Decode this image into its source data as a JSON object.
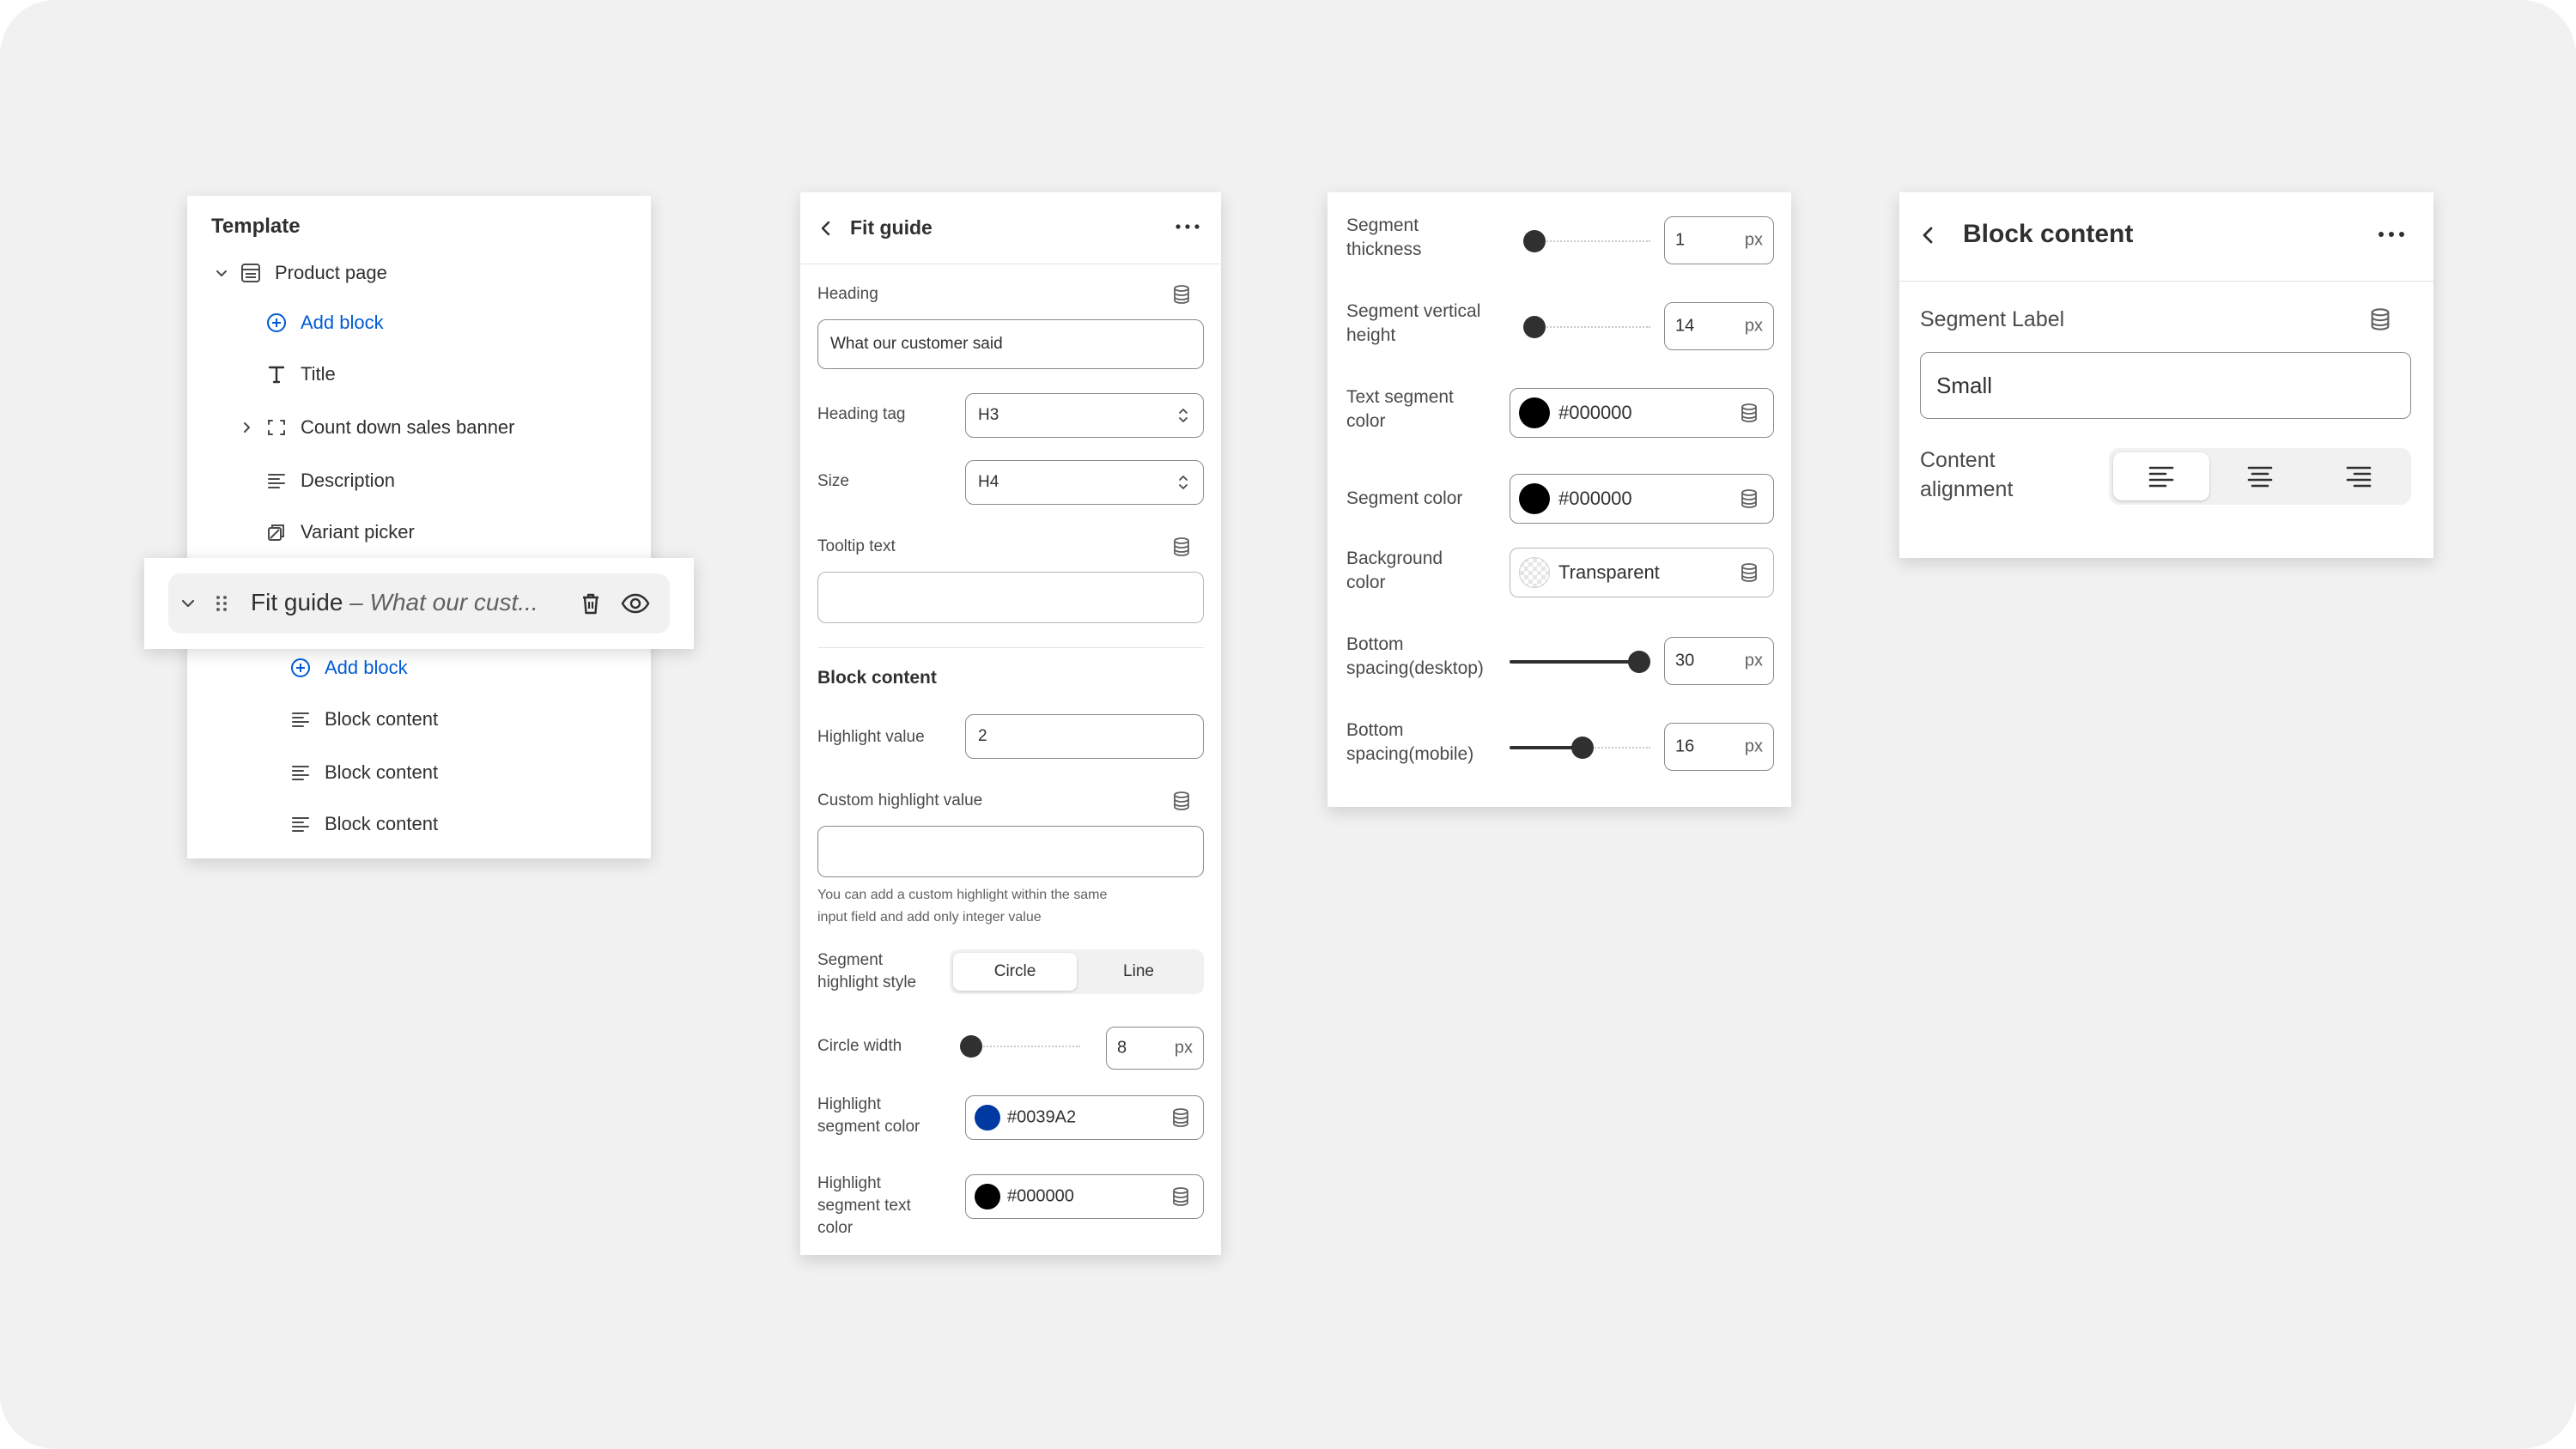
{
  "template_panel": {
    "title": "Template",
    "product_page": "Product page",
    "add_block_top": "Add block",
    "items": [
      "Title",
      "Count down sales banner",
      "Description",
      "Variant picker"
    ],
    "fit_guide_name": "Fit guide",
    "fit_guide_subtitle": " – What our cust...",
    "add_block_nested": "Add block",
    "nested_items": [
      "Block content",
      "Block content",
      "Block content"
    ]
  },
  "fit_guide_panel": {
    "title": "Fit guide",
    "heading_label": "Heading",
    "heading_value": "What our customer said",
    "heading_tag_label": "Heading tag",
    "heading_tag_value": "H3",
    "size_label": "Size",
    "size_value": "H4",
    "tooltip_label": "Tooltip text",
    "tooltip_value": "",
    "block_content_title": "Block content",
    "highlight_value_label": "Highlight value",
    "highlight_value": "2",
    "custom_highlight_label": "Custom highlight value",
    "custom_highlight_value": "",
    "help_line1": "You can add a custom highlight within the same",
    "help_line2": "input field and add only integer value",
    "seg_style_label1": "Segment",
    "seg_style_label2": "highlight style",
    "seg_style_options": [
      "Circle",
      "Line"
    ],
    "seg_style_selected": "Circle",
    "circle_width_label": "Circle width",
    "circle_width_value": "8",
    "circle_width_unit": "px",
    "circle_width_fraction": 0.0,
    "hl_seg_color_label1": "Highlight",
    "hl_seg_color_label2": "segment color",
    "hl_seg_color": "#0039A2",
    "hl_text_color_label1": "Highlight",
    "hl_text_color_label2": "segment text",
    "hl_text_color_label3": "color",
    "hl_text_color": "#000000"
  },
  "segment_panel": {
    "thickness_label1": "Segment",
    "thickness_label2": "thickness",
    "thickness_value": "1",
    "thickness_fraction": 0.0,
    "vheight_label1": "Segment vertical",
    "vheight_label2": "height",
    "vheight_value": "14",
    "vheight_fraction": 0.0,
    "text_color_label1": "Text segment",
    "text_color_label2": "color",
    "text_color": "#000000",
    "seg_color_label": "Segment color",
    "seg_color": "#000000",
    "bg_color_label1": "Background",
    "bg_color_label2": "color",
    "bg_color": "Transparent",
    "bottom_desktop_label1": "Bottom",
    "bottom_desktop_label2": "spacing(desktop)",
    "bottom_desktop_value": "30",
    "bottom_desktop_fraction": 0.92,
    "bottom_mobile_label1": "Bottom",
    "bottom_mobile_label2": "spacing(mobile)",
    "bottom_mobile_value": "16",
    "bottom_mobile_fraction": 0.52,
    "unit": "px"
  },
  "block_content_panel": {
    "title": "Block content",
    "segment_label_label": "Segment Label",
    "segment_label_value": "Small",
    "alignment_label1": "Content",
    "alignment_label2": "alignment",
    "alignment_selected": "left"
  },
  "colors": {
    "link": "#005bd3",
    "highlight_segment": "#0039A2",
    "text": "#303030"
  },
  "icons": [
    "chevron-down-icon",
    "template-icon",
    "plus-circle-icon",
    "text-icon",
    "chevron-right-icon",
    "section-icon",
    "text-block-icon",
    "variant-icon",
    "drag-handle-icon",
    "trash-icon",
    "eye-icon",
    "back-arrow-icon",
    "more-icon",
    "database-icon",
    "select-arrows-icon",
    "align-left-icon",
    "align-center-icon",
    "align-right-icon"
  ]
}
